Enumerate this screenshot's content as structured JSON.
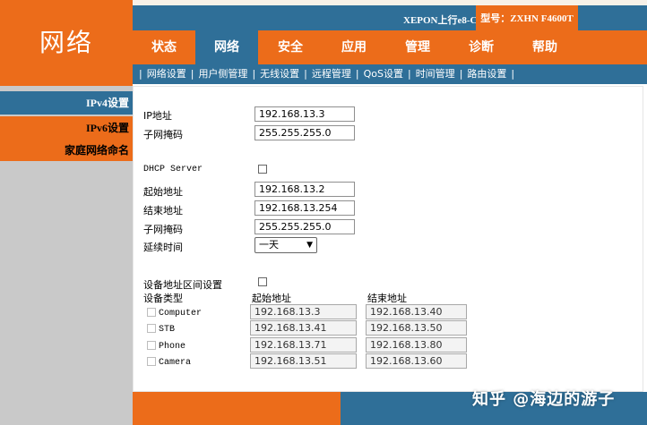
{
  "brand": {
    "logo": "网络"
  },
  "header": {
    "device_name": "XEPON上行e8-C",
    "model": "型号：ZXHN F4600T"
  },
  "nav": {
    "tabs": [
      "状态",
      "网络",
      "安全",
      "应用",
      "管理",
      "诊断",
      "帮助"
    ],
    "active": "网络"
  },
  "subnav": {
    "items": [
      "网络设置",
      "用户侧管理",
      "无线设置",
      "远程管理",
      "QoS设置",
      "时间管理",
      "路由设置"
    ],
    "active": "用户侧管理"
  },
  "sidebar": {
    "items": [
      "IPv4设置",
      "IPv6设置",
      "家庭网络命名"
    ],
    "active": "IPv4设置"
  },
  "form": {
    "ip_label": "IP地址",
    "ip_value": "192.168.13.3",
    "mask_label": "子网掩码",
    "mask_value": "255.255.255.0",
    "dhcp_label": "DHCP Server",
    "start_label": "起始地址",
    "start_value": "192.168.13.2",
    "end_label": "结束地址",
    "end_value": "192.168.13.254",
    "dhcp_mask_label": "子网掩码",
    "dhcp_mask_value": "255.255.255.0",
    "lease_label": "延续时间",
    "lease_value": "一天"
  },
  "range": {
    "title": "设备地址区间设置",
    "col_type": "设备类型",
    "col_start": "起始地址",
    "col_end": "结束地址",
    "rows": [
      {
        "type": "Computer",
        "start": "192.168.13.3",
        "end": "192.168.13.40"
      },
      {
        "type": "STB",
        "start": "192.168.13.41",
        "end": "192.168.13.50"
      },
      {
        "type": "Phone",
        "start": "192.168.13.71",
        "end": "192.168.13.80"
      },
      {
        "type": "Camera",
        "start": "192.168.13.51",
        "end": "192.168.13.60"
      }
    ]
  },
  "watermark": "知乎 @海边的游子",
  "colors": {
    "orange": "#ec6c1a",
    "blue": "#2f6f98",
    "grey": "#c9c9c9"
  },
  "icons": {
    "select": "chevron-down-icon"
  }
}
